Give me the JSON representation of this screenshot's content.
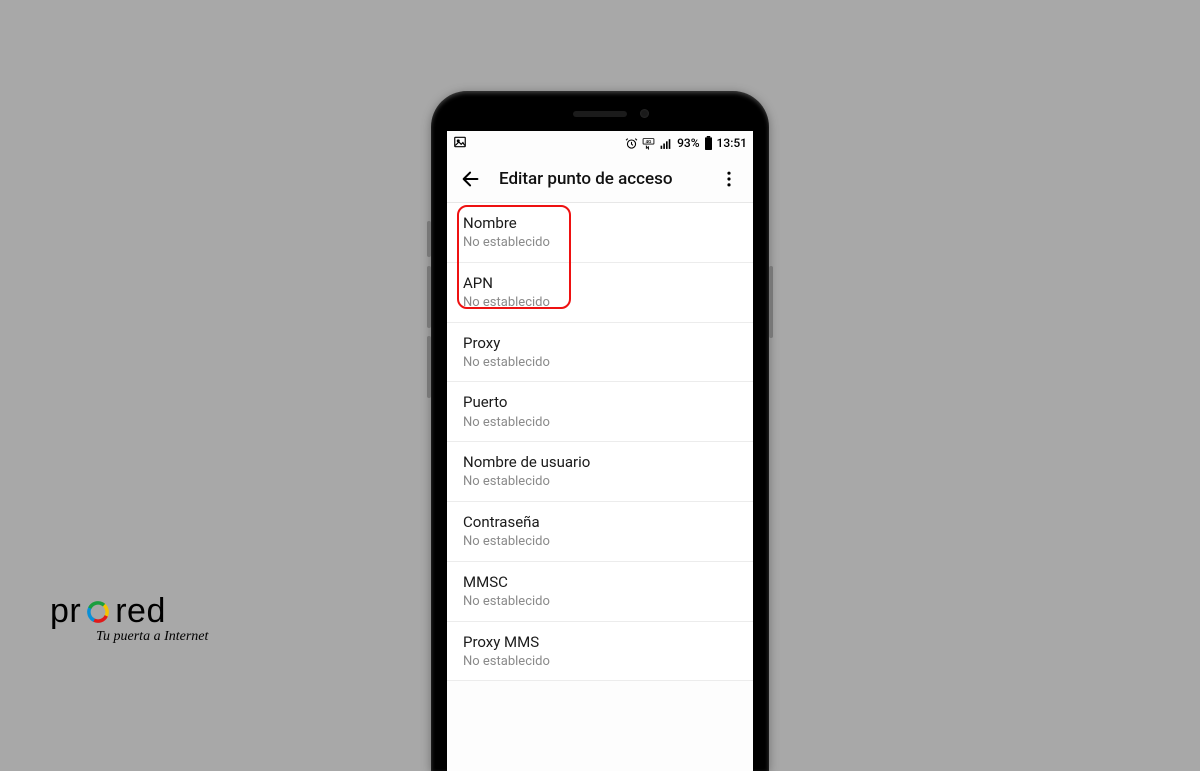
{
  "statusbar": {
    "battery_text": "93%",
    "time": "13:51"
  },
  "appbar": {
    "title": "Editar punto de acceso"
  },
  "items": [
    {
      "label": "Nombre",
      "value": "No establecido"
    },
    {
      "label": "APN",
      "value": "No establecido"
    },
    {
      "label": "Proxy",
      "value": "No establecido"
    },
    {
      "label": "Puerto",
      "value": "No establecido"
    },
    {
      "label": "Nombre de usuario",
      "value": "No establecido"
    },
    {
      "label": "Contraseña",
      "value": "No establecido"
    },
    {
      "label": "MMSC",
      "value": "No establecido"
    },
    {
      "label": "Proxy MMS",
      "value": "No establecido"
    }
  ],
  "logo": {
    "left": "pr",
    "right": "red",
    "tagline": "Tu puerta a Internet"
  }
}
